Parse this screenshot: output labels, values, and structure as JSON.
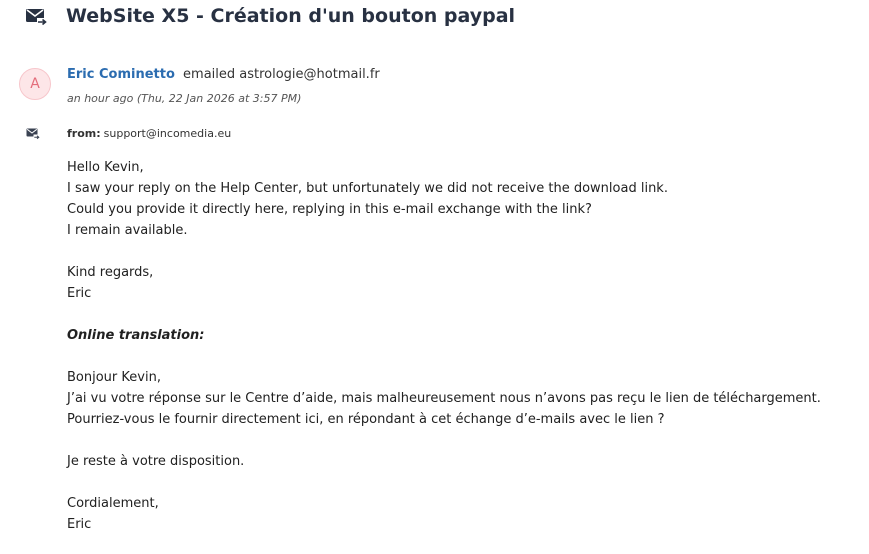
{
  "header": {
    "title": "WebSite X5 - Création d'un bouton paypal",
    "icon": "envelope-forward-icon"
  },
  "sender": {
    "avatar_letter": "A",
    "name": "Eric Cominetto",
    "action": "emailed astrologie@hotmail.fr",
    "timestamp": "an hour ago (Thu, 22 Jan 2026 at 3:57 PM)"
  },
  "from": {
    "icon": "envelope-forward-icon",
    "label": "from:",
    "address": "support@incomedia.eu"
  },
  "message": {
    "greeting": "Hello Kevin,",
    "line1": "I saw your reply on the Help Center, but unfortunately we did not receive the download link.",
    "line2": "Could you provide it directly here, replying in this e-mail exchange with the link?",
    "line3": "I remain available.",
    "closing": "Kind regards,",
    "signature": "Eric",
    "translation_heading": "Online translation:",
    "fr_greeting": "Bonjour Kevin,",
    "fr_line1": "J’ai vu votre réponse sur le Centre d’aide, mais malheureusement nous n’avons pas reçu le lien de téléchargement.",
    "fr_line2": "Pourriez-vous le fournir directement ici, en répondant à cet échange d’e-mails avec le lien ?",
    "fr_line3": "Je reste à votre disposition.",
    "fr_closing": "Cordialement,",
    "fr_signature": "Eric"
  },
  "colors": {
    "title": "#283142",
    "sender_name": "#2b6cb0",
    "avatar_bg": "#fde6e8",
    "avatar_text": "#e46d7b"
  }
}
